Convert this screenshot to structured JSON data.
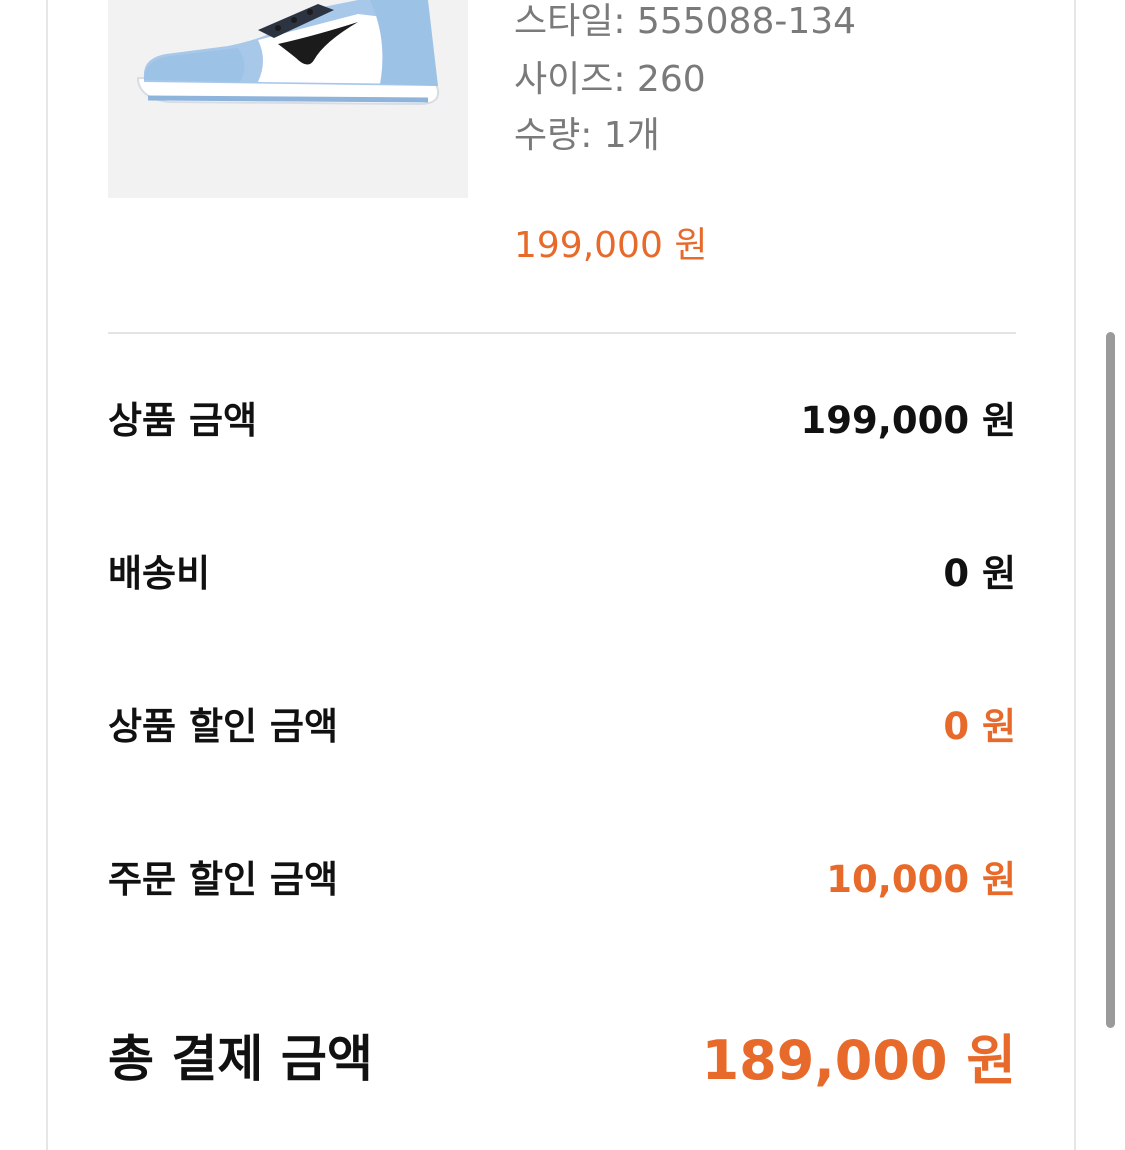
{
  "product": {
    "image_alt": "light-blue high-top sneaker",
    "style": "스타일: 555088-134",
    "size": "사이즈: 260",
    "quantity": "수량: 1개",
    "price": "199,000 원"
  },
  "summary": {
    "subtotal_label": "상품 금액",
    "subtotal_value": "199,000 원",
    "shipping_label": "배송비",
    "shipping_value": "0 원",
    "product_discount_label": "상품 할인 금액",
    "product_discount_value": "0 원",
    "order_discount_label": "주문 할인 금액",
    "order_discount_value": "10,000 원",
    "total_label": "총 결제 금액",
    "total_value": "189,000 원"
  },
  "colors": {
    "accent": "#e86a2b",
    "text_primary": "#111111",
    "text_secondary": "#7a7a7a",
    "sneaker_blue": "#9cc2e6"
  }
}
